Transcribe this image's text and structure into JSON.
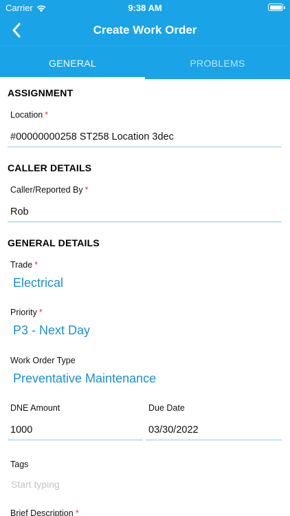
{
  "status_bar": {
    "carrier": "Carrier",
    "time": "9:38 AM"
  },
  "nav": {
    "title": "Create Work Order",
    "back_icon": "chevron-left-icon"
  },
  "tabs": [
    {
      "label": "GENERAL",
      "active": true
    },
    {
      "label": "PROBLEMS",
      "active": false
    }
  ],
  "assignment": {
    "section_title": "ASSIGNMENT",
    "location_label": "Location",
    "location_value": "#00000000258 ST258 Location 3dec"
  },
  "caller": {
    "section_title": "CALLER DETAILS",
    "caller_label": "Caller/Reported By",
    "caller_value": "Rob"
  },
  "general": {
    "section_title": "GENERAL DETAILS",
    "trade_label": "Trade",
    "trade_value": "Electrical",
    "priority_label": "Priority",
    "priority_value": "P3 - Next Day",
    "type_label": "Work Order Type",
    "type_value": "Preventative Maintenance",
    "dne_label": "DNE Amount",
    "dne_value": "1000",
    "due_label": "Due Date",
    "due_value": "03/30/2022",
    "tags_label": "Tags",
    "tags_placeholder": "Start typing",
    "brief_label": "Brief Description"
  },
  "required_marker": "*",
  "colors": {
    "brand": "#1aa3e6",
    "link": "#1a8fd9",
    "required": "#e53935"
  }
}
